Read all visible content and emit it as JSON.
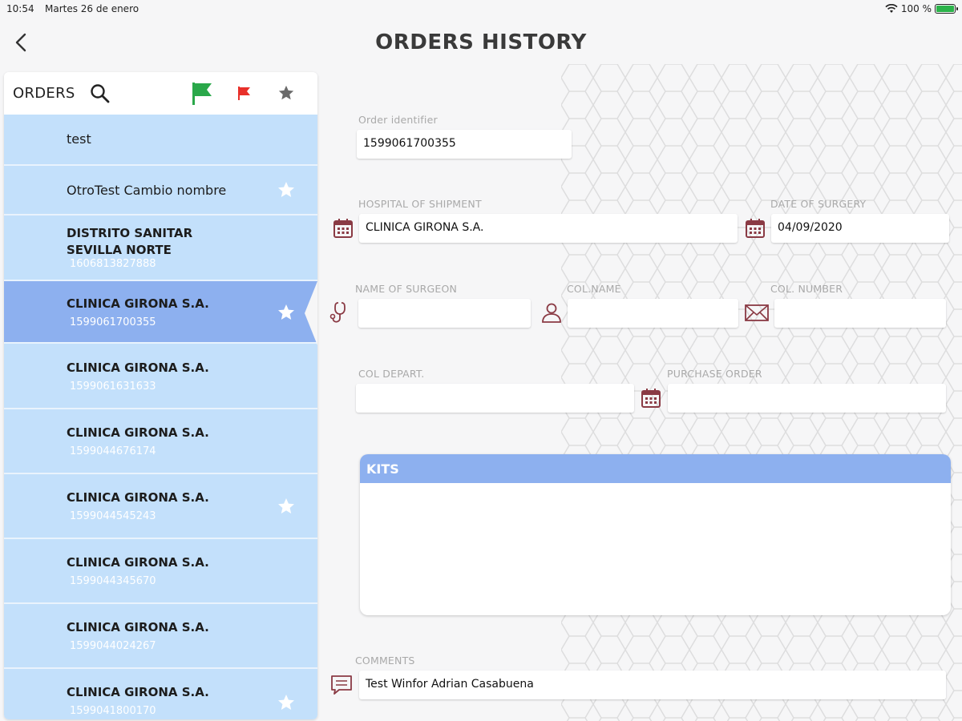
{
  "status_bar": {
    "time": "10:54",
    "date": "Martes 26 de enero",
    "wifi_icon": "wifi-icon",
    "battery_text": "100 %",
    "battery_level": 1.0
  },
  "header": {
    "title": "ORDERS HISTORY",
    "back_icon": "chevron-left-icon"
  },
  "orders_panel": {
    "title": "ORDERS",
    "icons": [
      "search-icon",
      "green-flag-icon",
      "red-flag-icon",
      "star-icon"
    ],
    "items": [
      {
        "name": "test",
        "id": "",
        "starred": false,
        "selected": false
      },
      {
        "name": "OtroTest Cambio nombre",
        "id": "",
        "starred": true,
        "selected": false
      },
      {
        "name": "DISTRITO SANITAR",
        "name2": "SEVILLA NORTE",
        "id": "1606813827888",
        "starred": false,
        "selected": false
      },
      {
        "name": "CLINICA GIRONA S.A.",
        "id": "1599061700355",
        "starred": true,
        "selected": true
      },
      {
        "name": "CLINICA GIRONA S.A.",
        "id": "1599061631633",
        "starred": false,
        "selected": false
      },
      {
        "name": "CLINICA GIRONA S.A.",
        "id": "1599044676174",
        "starred": false,
        "selected": false
      },
      {
        "name": "CLINICA GIRONA S.A.",
        "id": "1599044545243",
        "starred": true,
        "selected": false
      },
      {
        "name": "CLINICA GIRONA S.A.",
        "id": "1599044345670",
        "starred": false,
        "selected": false
      },
      {
        "name": "CLINICA GIRONA S.A.",
        "id": "1599044024267",
        "starred": false,
        "selected": false
      },
      {
        "name": "CLINICA GIRONA S.A.",
        "id": "1599041800170",
        "starred": true,
        "selected": false
      }
    ]
  },
  "form": {
    "order_identifier": {
      "label": "Order identifier",
      "value": "1599061700355"
    },
    "hospital": {
      "label": "HOSPITAL OF SHIPMENT",
      "value": "CLINICA GIRONA S.A.",
      "icon": "calendar-icon"
    },
    "date_of_surgery": {
      "label": "DATE OF SURGERY",
      "value": "04/09/2020",
      "icon": "calendar-icon"
    },
    "surgeon": {
      "label": "NAME OF SURGEON",
      "value": "",
      "icon": "stethoscope-icon"
    },
    "col_name": {
      "label": "COL.NAME",
      "value": "",
      "icon": "person-icon"
    },
    "col_number": {
      "label": "COL. NUMBER",
      "value": "",
      "icon": "envelope-icon"
    },
    "col_depart": {
      "label": "COL DEPART.",
      "value": ""
    },
    "purchase_order": {
      "label": "PURCHASE ORDER",
      "value": "",
      "icon": "calendar-icon"
    },
    "kits": {
      "title": "KITS"
    },
    "comments": {
      "label": "COMMENTS",
      "value": "Test Winfor Adrian Casabuena",
      "icon": "comment-icon"
    }
  },
  "colors": {
    "accent": "#8db0ef",
    "list_bg": "#c3e0fb",
    "icon_dark_red": "#8a3a44",
    "flag_green": "#2aa84a",
    "flag_red": "#e8302a"
  }
}
